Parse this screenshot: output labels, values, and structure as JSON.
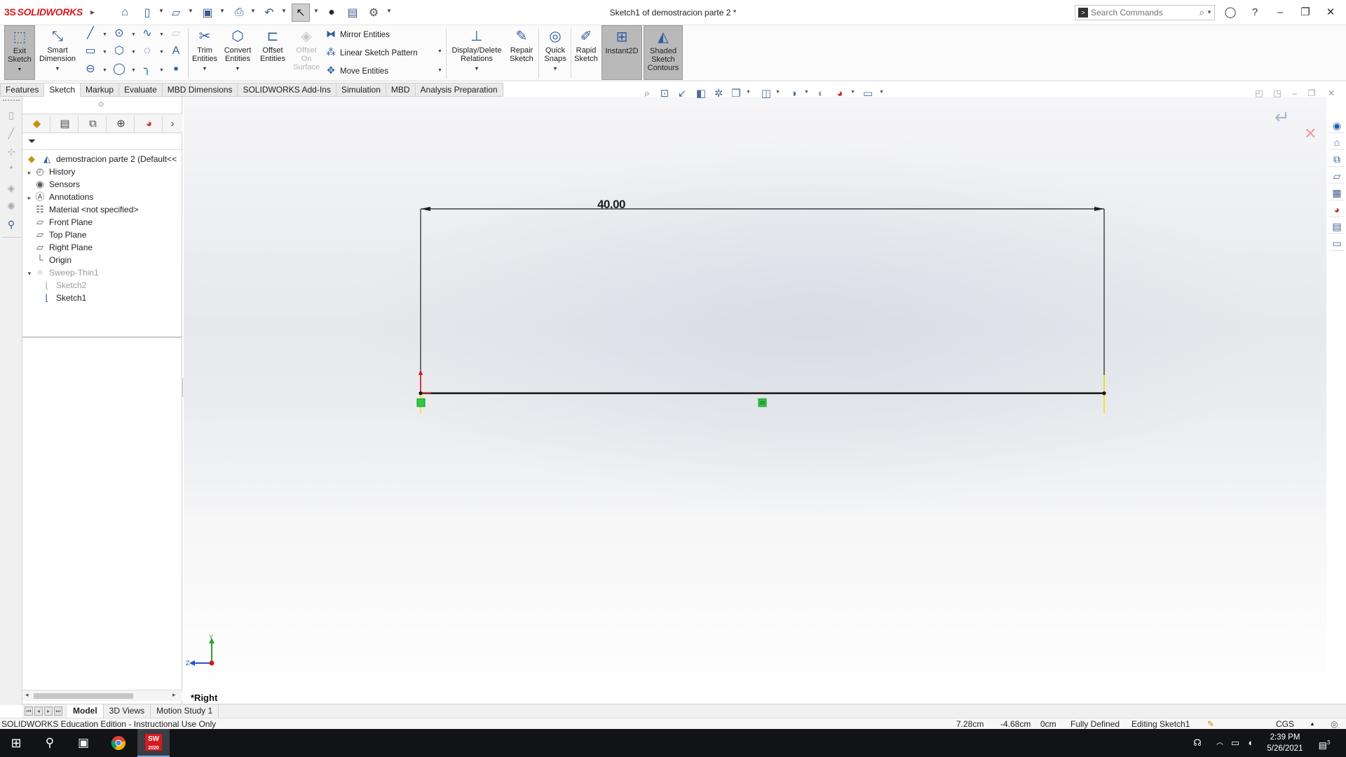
{
  "app": {
    "logo_mark": "3S",
    "logo_text": "SOLIDWORKS",
    "window_title": "Sketch1 of demostracion parte 2 *"
  },
  "search": {
    "placeholder": "Search Commands"
  },
  "ribbon": {
    "exit_sketch": "Exit Sketch",
    "smart_dimension": "Smart Dimension",
    "trim_entities": "Trim Entities",
    "convert_entities": "Convert Entities",
    "offset_entities": "Offset Entities",
    "offset_on_surface": "Offset On Surface",
    "mirror_entities": "Mirror Entities",
    "linear_sketch_pattern": "Linear Sketch Pattern",
    "move_entities": "Move Entities",
    "display_delete_relations": "Display/Delete Relations",
    "repair_sketch": "Repair Sketch",
    "quick_snaps": "Quick Snaps",
    "rapid_sketch": "Rapid Sketch",
    "instant2d": "Instant2D",
    "shaded_sketch_contours": "Shaded Sketch Contours"
  },
  "tabs": [
    {
      "label": "Features",
      "active": false
    },
    {
      "label": "Sketch",
      "active": true
    },
    {
      "label": "Markup",
      "active": false
    },
    {
      "label": "Evaluate",
      "active": false
    },
    {
      "label": "MBD Dimensions",
      "active": false
    },
    {
      "label": "SOLIDWORKS Add-Ins",
      "active": false
    },
    {
      "label": "Simulation",
      "active": false
    },
    {
      "label": "MBD",
      "active": false
    },
    {
      "label": "Analysis Preparation",
      "active": false
    }
  ],
  "tree": {
    "root": "demostracion parte 2  (Default<<",
    "items": {
      "history": "History",
      "sensors": "Sensors",
      "annotations": "Annotations",
      "material": "Material <not specified>",
      "front_plane": "Front Plane",
      "top_plane": "Top Plane",
      "right_plane": "Right Plane",
      "origin": "Origin",
      "sweep": "Sweep-Thin1",
      "sketch2": "Sketch2",
      "sketch1": "Sketch1"
    }
  },
  "sketch": {
    "dimension_value": "40.00",
    "view_label": "*Right",
    "triad_y": "Y",
    "triad_z": "Z"
  },
  "bottom_tabs": [
    {
      "label": "Model",
      "active": true
    },
    {
      "label": "3D Views",
      "active": false
    },
    {
      "label": "Motion Study 1",
      "active": false
    }
  ],
  "status": {
    "edition": "SOLIDWORKS Education Edition - Instructional Use Only",
    "x_coord": "7.28cm",
    "y_coord": "-4.68cm",
    "z_coord": "0cm",
    "sketch_state": "Fully Defined",
    "editing": "Editing Sketch1",
    "units": "CGS"
  },
  "taskbar": {
    "time": "2:39 PM",
    "date": "5/26/2021",
    "sw_badge": "2020",
    "notification_count": "3"
  }
}
